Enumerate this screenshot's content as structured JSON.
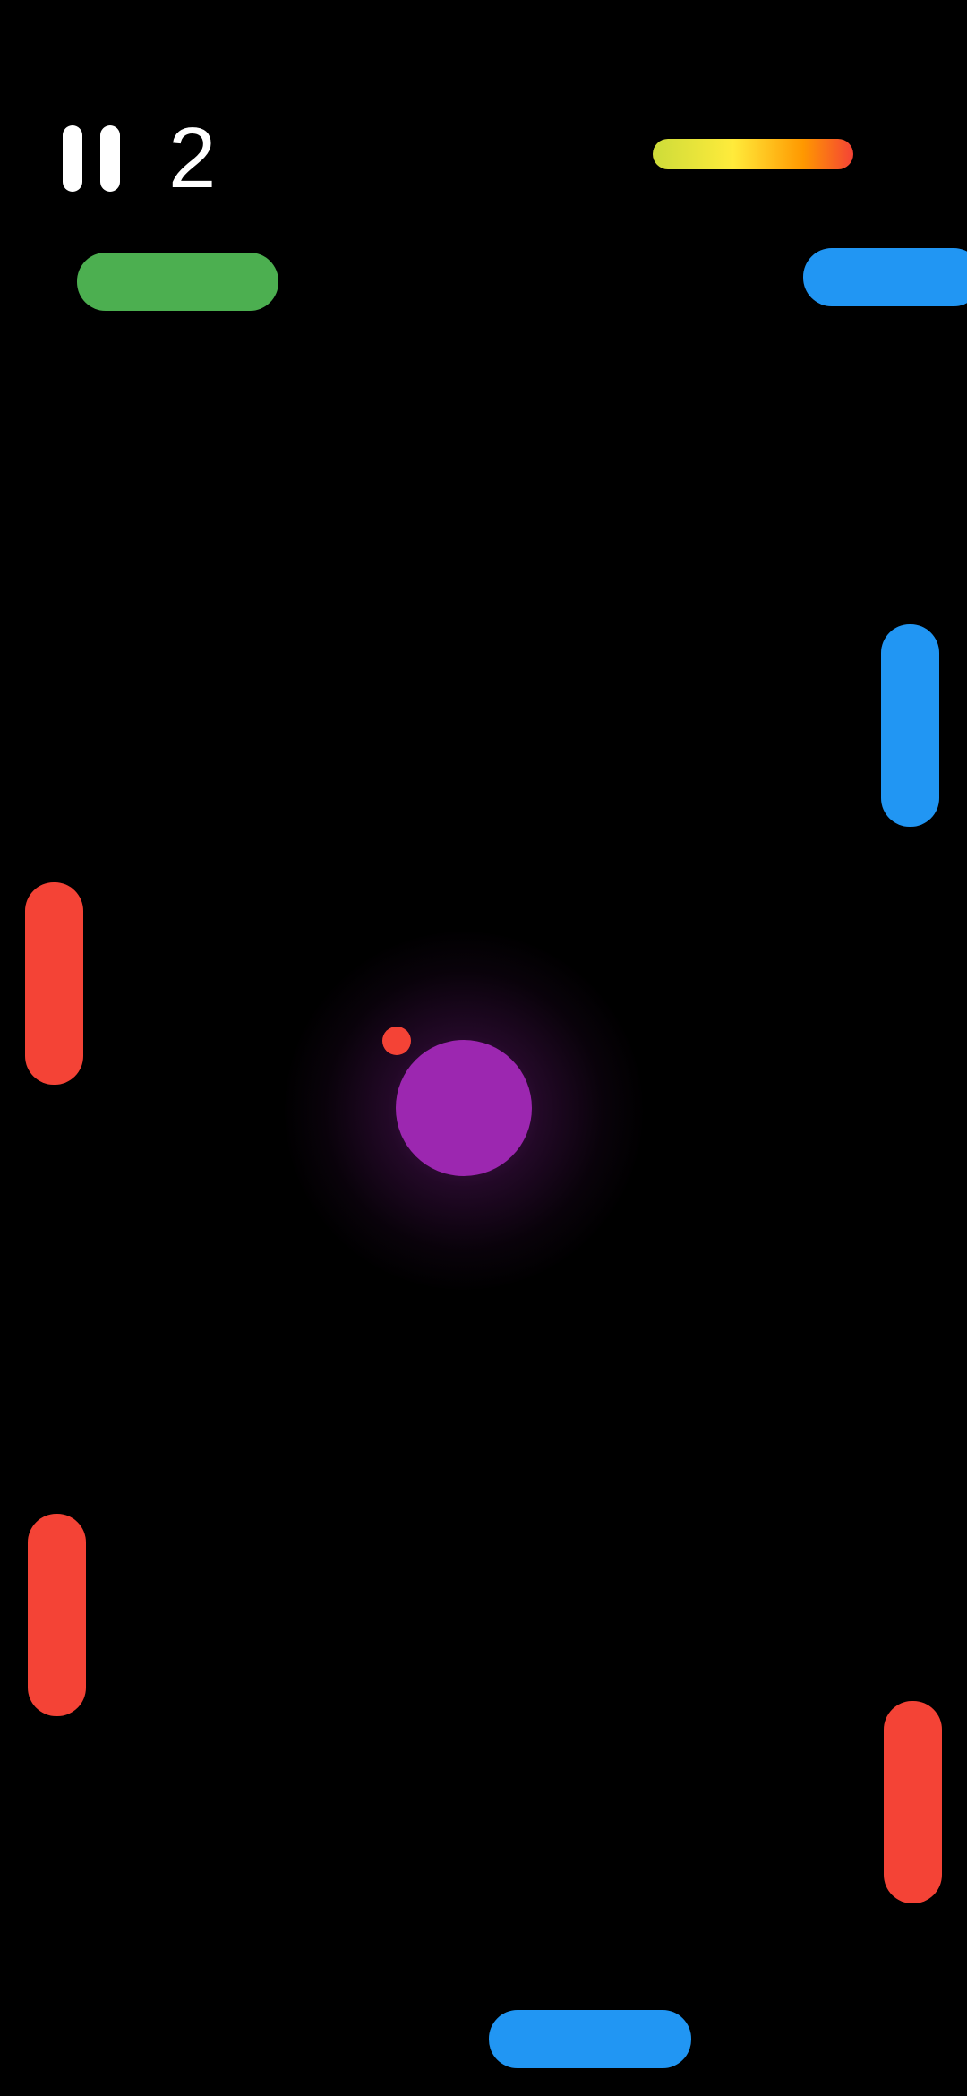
{
  "hud": {
    "score": "2",
    "pause_icon": "pause-icon",
    "meter_colors": [
      "#cddc39",
      "#ffeb3b",
      "#ff9800",
      "#f44336"
    ]
  },
  "colors": {
    "green": "#4caf50",
    "blue": "#2196f3",
    "red": "#f44336",
    "purple": "#9c27b0",
    "background": "#000000"
  },
  "player": {
    "color": "purple"
  },
  "orbit_dot": {
    "color": "red"
  },
  "paddles": [
    {
      "name": "paddle-top-left-green",
      "color": "green"
    },
    {
      "name": "paddle-top-right-blue",
      "color": "blue"
    },
    {
      "name": "paddle-right-blue",
      "color": "blue"
    },
    {
      "name": "paddle-left-red",
      "color": "red"
    },
    {
      "name": "paddle-lower-left-red",
      "color": "red"
    },
    {
      "name": "paddle-lower-right-red",
      "color": "red"
    },
    {
      "name": "paddle-bottom-blue",
      "color": "blue"
    }
  ]
}
